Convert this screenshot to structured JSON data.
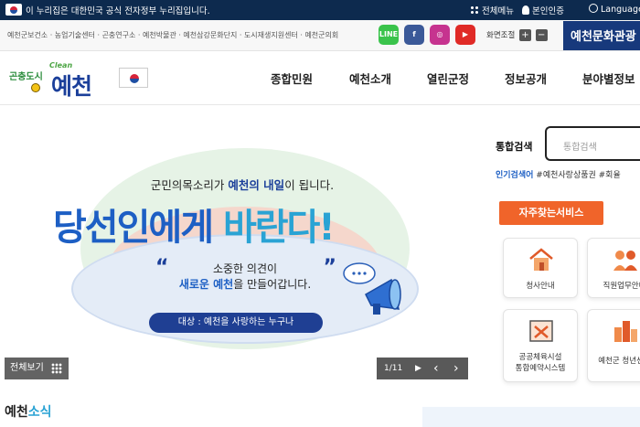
{
  "gov_banner": {
    "text": "이 누리집은 대한민국 공식 전자정부 누리집입니다.",
    "menu_all": "전체메뉴",
    "auth": "본인인증",
    "language": "Language"
  },
  "sites_bar": {
    "links": "예천군보건소 · 농업기술센터 · 곤충연구소 · 예천박물관 · 예천삼강문화단지 · 도시재생지원센터 · 예천군의회",
    "zoom_label": "화면조절",
    "zoom_in": "+",
    "zoom_out": "−",
    "culture": "예천문화관광"
  },
  "social": [
    {
      "name": "line",
      "label": "LINE",
      "color": "#3ac34b"
    },
    {
      "name": "facebook",
      "label": "f",
      "color": "#3b5998"
    },
    {
      "name": "instagram",
      "label": "◎",
      "color": "#c6338f"
    },
    {
      "name": "youtube",
      "label": "▶",
      "color": "#e02a26"
    }
  ],
  "header": {
    "logo_small": "곤충도시",
    "logo_clean": "Clean",
    "logo_big": "예천",
    "nav": [
      "종합민원",
      "예천소개",
      "열린군정",
      "정보공개",
      "분야별정보"
    ]
  },
  "banner": {
    "line1_prefix": "군민의목소리가 ",
    "line1_highlight": "예천의 내일",
    "line1_suffix": "이 됩니다.",
    "headline_a": "당선인에게 ",
    "headline_b": "바란다!",
    "quote_open": "“",
    "quote_close": "”",
    "quote_line1": "소중한 의견이",
    "quote_line2_hl": "새로운 예천",
    "quote_line2_rest": "을 만들어갑니다.",
    "target": "대상 : 예천을 사랑하는 누구나",
    "view_all": "전체보기",
    "pager": "1/11",
    "pager_play": "▶",
    "pager_prev": "‹",
    "pager_next": "›"
  },
  "search": {
    "label": "통합검색",
    "placeholder": "통합검색",
    "popular_label": "인기검색어",
    "popular": "#예천사랑상품권 #회율"
  },
  "services": {
    "title": "자주찾는서비스",
    "items": [
      {
        "label": "청사안내",
        "icon": "building-icon"
      },
      {
        "label": "직원업무안내",
        "icon": "staff-icon"
      },
      {
        "label": "공공체육시설\n통합예약시스템",
        "icon": "facility-icon"
      },
      {
        "label": "예천군 청년센터",
        "icon": "city-icon"
      }
    ]
  },
  "news": {
    "prefix": "예천",
    "suffix": "소식"
  },
  "colors": {
    "gov_bar": "#0d2a4e",
    "accent_orange": "#f0642a",
    "brand_blue": "#1b3f9a",
    "light_blue": "#2aa3d4"
  }
}
